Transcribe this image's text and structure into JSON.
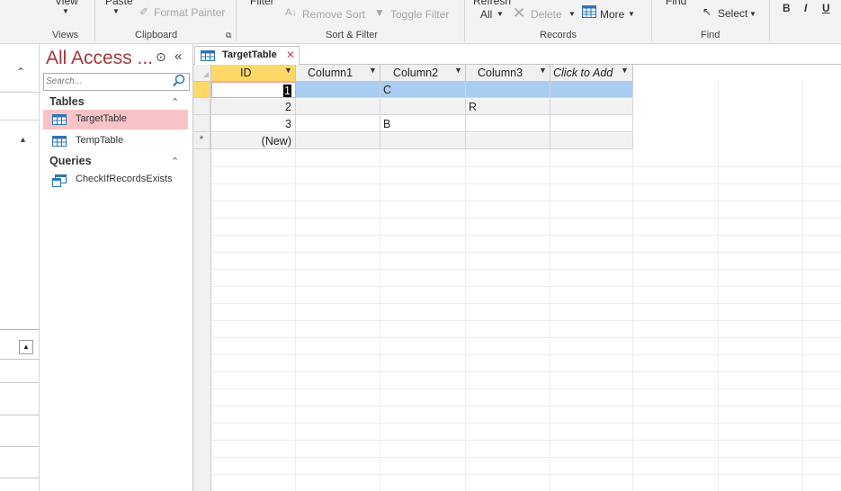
{
  "ribbon": {
    "view_label": "View",
    "paste_label": "Paste",
    "format_painter_label": "Format Painter",
    "filter_label": "Filter",
    "remove_sort_label": "Remove Sort",
    "toggle_filter_label": "Toggle Filter",
    "refresh_label": "Refresh",
    "refresh_all_label": "All",
    "delete_label": "Delete",
    "more_label": "More",
    "find_label": "Find",
    "select_label": "Select",
    "bold_label": "B",
    "italic_label": "I",
    "underline_label": "U",
    "groups": {
      "views": "Views",
      "clipboard": "Clipboard",
      "sort_filter": "Sort & Filter",
      "records": "Records",
      "find": "Find"
    }
  },
  "nav": {
    "title": "All Access ...",
    "search_placeholder": "Search...",
    "groups": [
      {
        "label": "Tables",
        "items": [
          {
            "label": "TargetTable",
            "selected": true
          },
          {
            "label": "TempTable",
            "selected": false
          }
        ]
      },
      {
        "label": "Queries",
        "items": [
          {
            "label": "CheckIfRecordsExists",
            "selected": false
          }
        ]
      }
    ]
  },
  "document": {
    "tab_title": "TargetTable",
    "columns": [
      "ID",
      "Column1",
      "Column2",
      "Column3",
      "Click to Add"
    ],
    "rows": [
      {
        "id": "1",
        "col1": "",
        "col2": "C",
        "col3": ""
      },
      {
        "id": "2",
        "col1": "",
        "col2": "",
        "col3": "R"
      },
      {
        "id": "3",
        "col1": "",
        "col2": "B",
        "col3": ""
      }
    ],
    "new_row_label": "(New)",
    "new_row_marker": "*"
  },
  "colors": {
    "nav_title": "#a4373a",
    "selected_nav_item": "#f7c3c6",
    "selected_row": "#a9cdf0",
    "id_header_active": "#ffd966"
  }
}
